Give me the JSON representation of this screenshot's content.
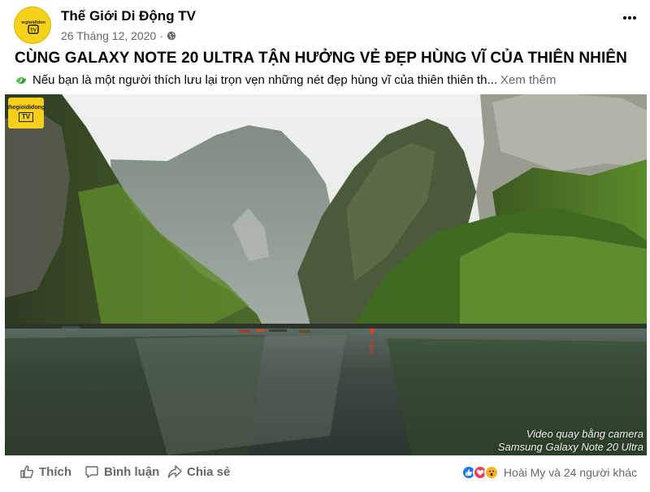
{
  "post": {
    "page_name": "Thế Giới Di Động TV",
    "date": "26 Tháng 12, 2020",
    "dot": "·",
    "headline": "CÙNG GALAXY NOTE 20 ULTRA TẬN HƯỞNG VẺ ĐẸP HÙNG VĨ CỦA THIÊN NHIÊN",
    "caption": "Nếu bạn là một người thích lưu lại trọn vẹn những nét đẹp hùng vĩ của thiên thiên th...",
    "see_more": "Xem thêm"
  },
  "media": {
    "watermark_top": "thegioididong",
    "watermark_tv": "TV",
    "note_line1": "Video quay bằng camera",
    "note_line2": "Samsung Galaxy Note 20 Ultra"
  },
  "actions": {
    "like": "Thích",
    "comment": "Bình luận",
    "share": "Chia sẻ"
  },
  "reactions": {
    "summary": "Hoài My và 24 người khác",
    "types": [
      "like",
      "love",
      "wow"
    ]
  },
  "colors": {
    "brand_yellow": "#f7d21c",
    "like_blue": "#1877f2",
    "love_red": "#f33e58",
    "wow_yellow": "#f7b125",
    "muted_text": "#65676b"
  },
  "icons": {
    "more": "more-dots-icon",
    "audience": "globe-icon",
    "caption_emoji": "recycle-leaf-icon"
  }
}
